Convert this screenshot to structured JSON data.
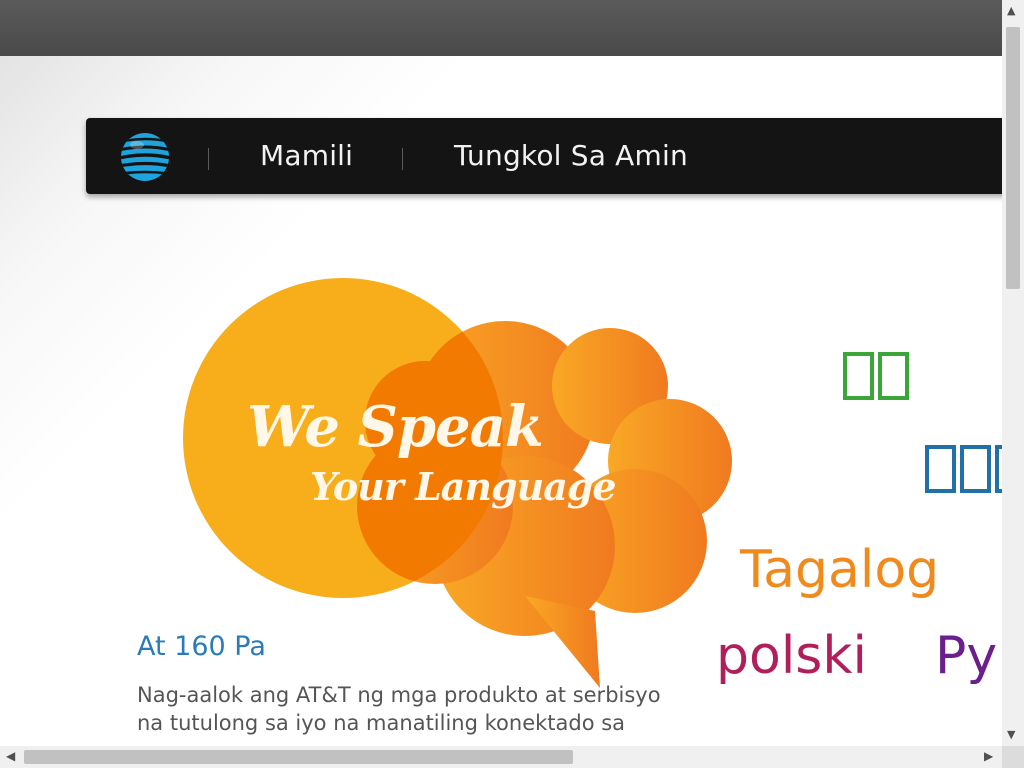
{
  "nav": {
    "brand_icon": "att-globe-icon",
    "links": [
      "Mamili",
      "Tungkol Sa Amin"
    ]
  },
  "hero": {
    "headline_line1": "We Speak",
    "headline_line2": "Your Language",
    "colors": {
      "circle": "#f8ad1a",
      "bubble_start": "#f9a825",
      "bubble_end": "#f07a1f",
      "overlap": "#f27a00"
    }
  },
  "languages": [
    {
      "text": "",
      "color": "#3aa63a"
    },
    {
      "text": "",
      "color": "#2170a8"
    },
    {
      "text": "Tagalog",
      "color": "#f08a1c"
    },
    {
      "text": "polski",
      "color": "#b01f5c"
    },
    {
      "text": "Py",
      "color": "#6a1f8c"
    }
  ],
  "content": {
    "subtitle": "At 160 Pa",
    "paragraph_line1": "Nag-aalok ang AT&T ng mga produkto at serbisyo",
    "paragraph_line2": "na tutulong sa iyo na manatiling konektado sa",
    "paragraph_line3": "…"
  },
  "scrollbars": {
    "up": "▲",
    "down": "▼",
    "left": "◀",
    "right": "▶"
  }
}
